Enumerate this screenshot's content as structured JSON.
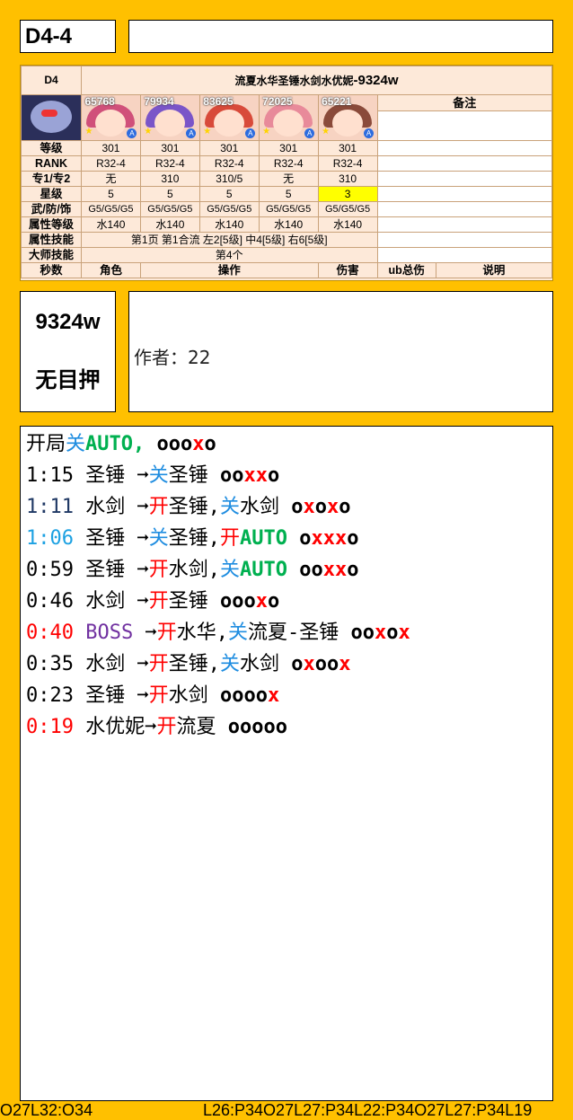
{
  "title": "D4-4",
  "card": {
    "stage": "D4",
    "team_title": "流夏水华圣锤水剑水优妮",
    "team_damage": "-9324w",
    "notes_header": "备注",
    "members": [
      {
        "power": "65768",
        "hair": "#d0507a"
      },
      {
        "power": "79934",
        "hair": "#7a55c8"
      },
      {
        "power": "83625",
        "hair": "#d84a3a"
      },
      {
        "power": "72025",
        "hair": "#e88a9a"
      },
      {
        "power": "65221",
        "hair": "#8a4a3a"
      }
    ],
    "rows": [
      {
        "label": "等级",
        "values": [
          "301",
          "301",
          "301",
          "301",
          "301"
        ]
      },
      {
        "label": "RANK",
        "values": [
          "R32-4",
          "R32-4",
          "R32-4",
          "R32-4",
          "R32-4"
        ]
      },
      {
        "label": "专1/专2",
        "values": [
          "无",
          "310",
          "310/5",
          "无",
          "310"
        ]
      },
      {
        "label": "星级",
        "values": [
          "5",
          "5",
          "5",
          "5",
          "3"
        ]
      },
      {
        "label": "武/防/饰",
        "values": [
          "G5/G5/G5",
          "G5/G5/G5",
          "G5/G5/G5",
          "G5/G5/G5",
          "G5/G5/G5"
        ]
      },
      {
        "label": "属性等级",
        "values": [
          "水140",
          "水140",
          "水140",
          "水140",
          "水140"
        ]
      }
    ],
    "attr_skill_label": "属性技能",
    "attr_skill_value": "第1页 第1合流 左2[5级] 中4[5级] 右6[5级]",
    "master_skill_label": "大师技能",
    "master_skill_value": "第4个",
    "bottom_headers": [
      "秒数",
      "角色",
      "操作",
      "伤害",
      "ub总伤",
      "说明"
    ]
  },
  "damage_box": {
    "value": "9324w",
    "note": "无目押"
  },
  "author": "作者：22",
  "timeline": [
    [
      [
        "开局",
        "black"
      ],
      [
        "关",
        "blue"
      ],
      [
        "AUTO,",
        "green"
      ],
      [
        " ",
        "black"
      ],
      [
        "ooo",
        "ox"
      ],
      [
        "x",
        "red ox"
      ],
      [
        "o",
        "ox"
      ]
    ],
    [
      [
        "1:15 圣锤 ➞",
        "black"
      ],
      [
        "关",
        "blue"
      ],
      [
        "圣锤 ",
        "black"
      ],
      [
        "oo",
        "ox"
      ],
      [
        "xx",
        "red ox"
      ],
      [
        "o",
        "ox"
      ]
    ],
    [
      [
        "1:11",
        "navy"
      ],
      [
        " 水剑 ➞",
        "black"
      ],
      [
        "开",
        "red"
      ],
      [
        "圣锤,",
        "black"
      ],
      [
        "关",
        "blue"
      ],
      [
        "水剑 ",
        "black"
      ],
      [
        "o",
        "ox"
      ],
      [
        "x",
        "red ox"
      ],
      [
        "o",
        "ox"
      ],
      [
        "x",
        "red ox"
      ],
      [
        "o",
        "ox"
      ]
    ],
    [
      [
        "1:06",
        "cyan"
      ],
      [
        " 圣锤 ➞",
        "black"
      ],
      [
        "关",
        "blue"
      ],
      [
        "圣锤,",
        "black"
      ],
      [
        "开",
        "red"
      ],
      [
        "AUTO ",
        "green"
      ],
      [
        "o",
        "ox"
      ],
      [
        "xxx",
        "red ox"
      ],
      [
        "o",
        "ox"
      ]
    ],
    [
      [
        "0:59 圣锤 ➞",
        "black"
      ],
      [
        "开",
        "red"
      ],
      [
        "水剑,",
        "black"
      ],
      [
        "关",
        "blue"
      ],
      [
        "AUTO ",
        "green"
      ],
      [
        "oo",
        "ox"
      ],
      [
        "xx",
        "red ox"
      ],
      [
        "o",
        "ox"
      ]
    ],
    [
      [
        "0:46 水剑 ➞",
        "black"
      ],
      [
        "开",
        "red"
      ],
      [
        "圣锤 ",
        "black"
      ],
      [
        "ooo",
        "ox"
      ],
      [
        "x",
        "red ox"
      ],
      [
        "o",
        "ox"
      ]
    ],
    [
      [
        "0:40",
        "red"
      ],
      [
        " BOSS",
        "purple"
      ],
      [
        " ➞",
        "black"
      ],
      [
        "开",
        "red"
      ],
      [
        "水华,",
        "black"
      ],
      [
        "关",
        "blue"
      ],
      [
        "流夏-圣锤 ",
        "black"
      ],
      [
        "oo",
        "ox"
      ],
      [
        "x",
        "red ox"
      ],
      [
        "o",
        "ox"
      ],
      [
        "x",
        "red ox"
      ]
    ],
    [
      [
        "0:35 水剑 ➞",
        "black"
      ],
      [
        "开",
        "red"
      ],
      [
        "圣锤,",
        "black"
      ],
      [
        "关",
        "blue"
      ],
      [
        "水剑 ",
        "black"
      ],
      [
        "o",
        "ox"
      ],
      [
        "x",
        "red ox"
      ],
      [
        "oo",
        "ox"
      ],
      [
        "x",
        "red ox"
      ]
    ],
    [
      [
        "0:23 圣锤 ➞",
        "black"
      ],
      [
        "开",
        "red"
      ],
      [
        "水剑 ",
        "black"
      ],
      [
        "oooo",
        "ox"
      ],
      [
        "x",
        "red ox"
      ]
    ],
    [
      [
        "0:19",
        "red"
      ],
      [
        " 水优妮➞",
        "black"
      ],
      [
        "开",
        "red"
      ],
      [
        "流夏 ",
        "black"
      ],
      [
        "ooooo",
        "ox"
      ]
    ]
  ],
  "footer": {
    "left": "O27L32:O34",
    "right": "L26:P34O27L27:P34L22:P34O27L27:P34L19"
  },
  "colors": {
    "background": "#ffc000",
    "card": "#fde9d9",
    "star_highlight": "#ffff00"
  }
}
